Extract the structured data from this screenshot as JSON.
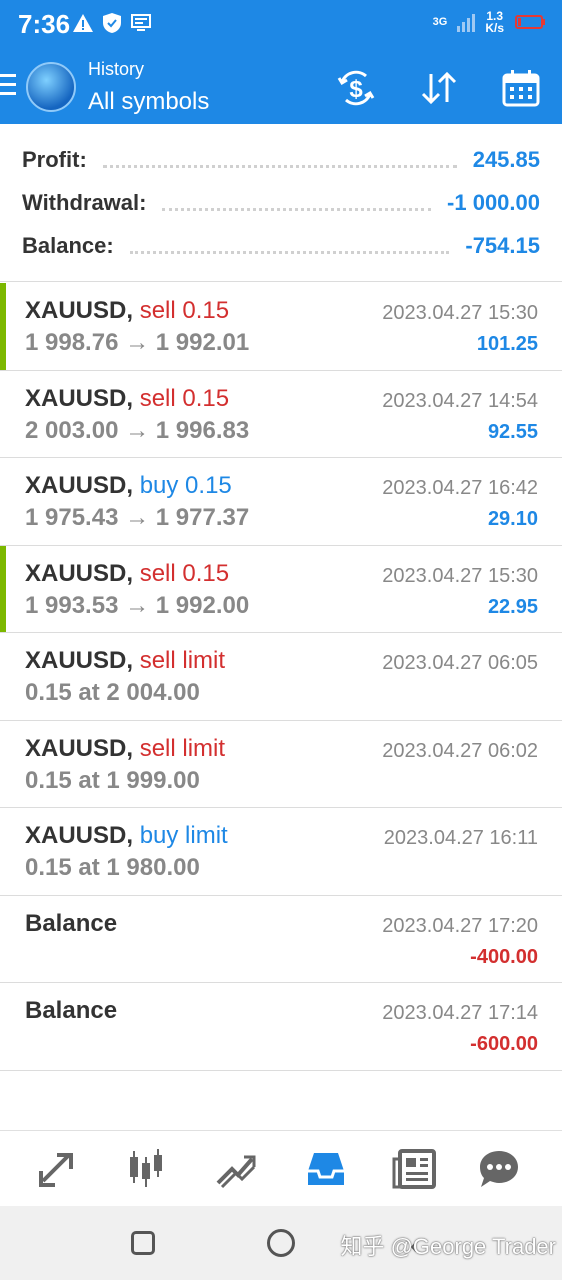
{
  "status_bar": {
    "time": "7:36",
    "network_type": "3G",
    "speed": "1.3",
    "speed_unit": "K/s"
  },
  "app_bar": {
    "subtitle": "History",
    "title": "All symbols",
    "icons": [
      "currency-exchange-icon",
      "sort-icon",
      "calendar-icon"
    ]
  },
  "summary": {
    "profit_label": "Profit:",
    "profit_value": "245.85",
    "withdrawal_label": "Withdrawal:",
    "withdrawal_value": "-1 000.00",
    "balance_label": "Balance:",
    "balance_value": "-754.15"
  },
  "items": [
    {
      "symbol": "XAUUSD,",
      "type": "sell 0.15",
      "detail": "1 998.76 → 1 992.01",
      "time": "2023.04.27 15:30",
      "profit": "101.25"
    },
    {
      "symbol": "XAUUSD,",
      "type": "sell 0.15",
      "detail": "2 003.00 → 1 996.83",
      "time": "2023.04.27 14:54",
      "profit": "92.55"
    },
    {
      "symbol": "XAUUSD,",
      "type": "buy 0.15",
      "detail": "1 975.43 → 1 977.37",
      "time": "2023.04.27 16:42",
      "profit": "29.10"
    },
    {
      "symbol": "XAUUSD,",
      "type": "sell 0.15",
      "detail": "1 993.53 → 1 992.00",
      "time": "2023.04.27 15:30",
      "profit": "22.95"
    },
    {
      "symbol": "XAUUSD,",
      "type": "sell limit",
      "detail": "0.15 at 2 004.00",
      "time": "2023.04.27 06:05",
      "profit": ""
    },
    {
      "symbol": "XAUUSD,",
      "type": "sell limit",
      "detail": "0.15 at 1 999.00",
      "time": "2023.04.27 06:02",
      "profit": ""
    },
    {
      "symbol": "XAUUSD,",
      "type": "buy limit",
      "detail": "0.15 at 1 980.00",
      "time": "2023.04.27 16:11",
      "profit": ""
    },
    {
      "symbol": "Balance",
      "type": "",
      "detail": "",
      "time": "2023.04.27 17:20",
      "profit": "-400.00"
    },
    {
      "symbol": "Balance",
      "type": "",
      "detail": "",
      "time": "2023.04.27 17:14",
      "profit": "-600.00"
    }
  ],
  "bottom_nav": {
    "tabs": [
      "quotes-icon",
      "chart-icon",
      "trade-icon",
      "history-icon",
      "news-icon",
      "chat-icon"
    ],
    "active": "history-icon"
  },
  "watermark": "知乎 @George Trader",
  "colors": {
    "accent": "#1e88e5",
    "sell": "#d32f2f",
    "buy": "#1e88e5",
    "marker": "#7cb800"
  }
}
